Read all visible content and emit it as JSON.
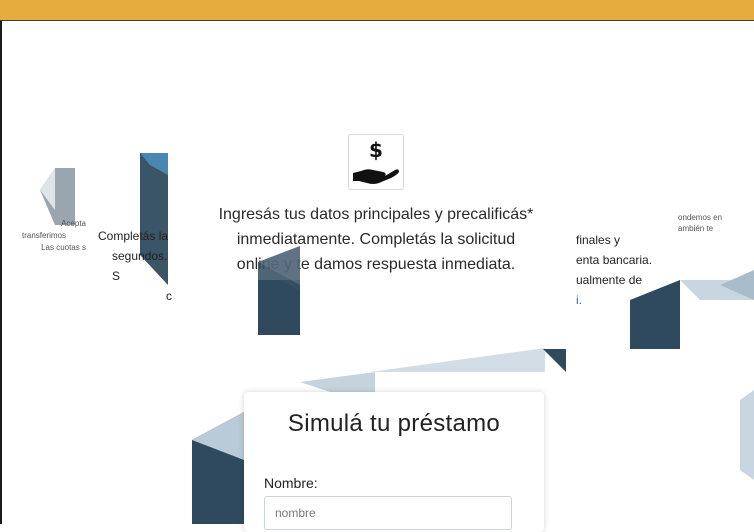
{
  "hero": {
    "icon": "money-hand-icon",
    "text_line1": "Ingresás tus datos principales y precalificás*",
    "text_line2": "inmediatamente. Completás la solicitud",
    "text_line3": "online y te damos respuesta inmediata."
  },
  "slides": {
    "left_small_1": "Acepta",
    "left_small_2": "transferimos",
    "left_small_3": "Las cuotas s",
    "left_mid_1": "Completás la",
    "left_mid_2": "segundos. S",
    "left_mid_3": "c",
    "right_small_1": "ondemos en",
    "right_small_2": "ambién te",
    "right_mid_1": "finales y",
    "right_mid_2": "enta bancaria.",
    "right_mid_3": "ualmente de",
    "right_mid_4": "i."
  },
  "simulator": {
    "title": "Simulá tu préstamo",
    "name_label": "Nombre:",
    "name_placeholder": "nombre"
  },
  "colors": {
    "topbar": "#e6ac3d",
    "shape_dark": "#2f4a5e",
    "shape_light": "#b9cad8"
  }
}
